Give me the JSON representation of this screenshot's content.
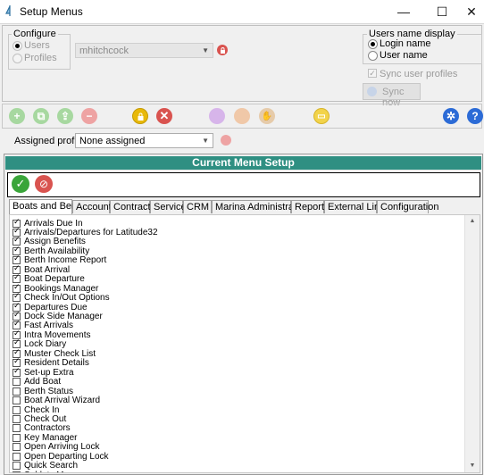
{
  "window": {
    "title": "Setup Menus",
    "minimize": "—",
    "maximize": "☐",
    "close": "✕"
  },
  "configure": {
    "legend": "Configure",
    "options": [
      "Users",
      "Profiles"
    ],
    "selected_user": "mhitchcock"
  },
  "display": {
    "legend": "Users name display",
    "options": [
      "Login name",
      "User name"
    ],
    "selected": "Login name",
    "sync_label": "Sync user profiles",
    "sync_button": "Sync now"
  },
  "toolbar": {
    "icons": [
      "add-icon",
      "copy-icon",
      "export-icon",
      "remove-icon",
      "lock-icon",
      "delete-icon",
      "group-icon",
      "person-icon",
      "handshake-icon",
      "notes-icon",
      "settings-icon",
      "help-icon"
    ],
    "colors": {
      "green": "#5cb85c",
      "red": "#d9534f",
      "gold": "#e8b90a",
      "purple": "#c79be0",
      "blue": "#2c6bd6"
    }
  },
  "profile": {
    "label": "Assigned profile:",
    "value": "None assigned"
  },
  "menu_setup": {
    "header": "Current Menu Setup",
    "tabs": [
      "Boats and Berths",
      "Accounts",
      "Contracts",
      "Services",
      "CRM",
      "Marina Administration",
      "Reports",
      "External Links",
      "Configuration"
    ],
    "items": [
      {
        "label": "Arrivals Due In",
        "checked": true
      },
      {
        "label": "Arrivals/Departures for Latitude32",
        "checked": true
      },
      {
        "label": "Assign Benefits",
        "checked": true
      },
      {
        "label": "Berth Availability",
        "checked": true
      },
      {
        "label": "Berth Income Report",
        "checked": true
      },
      {
        "label": "Boat Arrival",
        "checked": true
      },
      {
        "label": "Boat Departure",
        "checked": true
      },
      {
        "label": "Bookings Manager",
        "checked": true
      },
      {
        "label": "Check In/Out Options",
        "checked": true
      },
      {
        "label": "Departures Due",
        "checked": true
      },
      {
        "label": "Dock Side Manager",
        "checked": true
      },
      {
        "label": "Fast Arrivals",
        "checked": true
      },
      {
        "label": "Intra Movements",
        "checked": true
      },
      {
        "label": "Lock Diary",
        "checked": true
      },
      {
        "label": "Muster Check List",
        "checked": true
      },
      {
        "label": "Resident Details",
        "checked": true
      },
      {
        "label": "Set-up Extra",
        "checked": true
      },
      {
        "label": "Add Boat",
        "checked": false
      },
      {
        "label": "Berth Status",
        "checked": false
      },
      {
        "label": "Boat Arrival Wizard",
        "checked": false
      },
      {
        "label": "Check In",
        "checked": false
      },
      {
        "label": "Check Out",
        "checked": false
      },
      {
        "label": "Contractors",
        "checked": false
      },
      {
        "label": "Key Manager",
        "checked": false
      },
      {
        "label": "Open Arriving Lock",
        "checked": false
      },
      {
        "label": "Open Departing Lock",
        "checked": false
      },
      {
        "label": "Quick Search",
        "checked": false
      },
      {
        "label": "Sublets Manager",
        "checked": false
      }
    ]
  }
}
